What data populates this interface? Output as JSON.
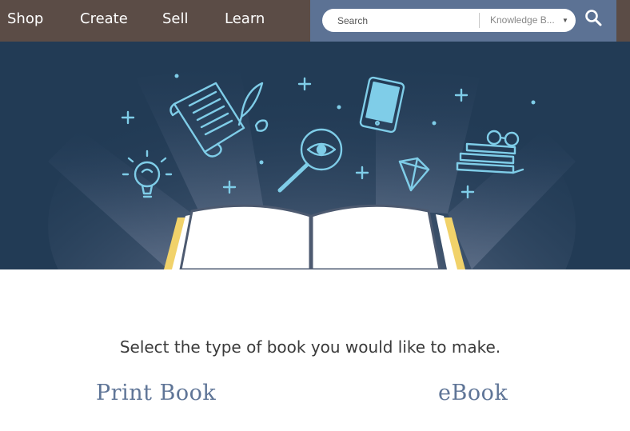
{
  "nav": {
    "items": [
      {
        "label": "Shop"
      },
      {
        "label": "Create"
      },
      {
        "label": "Sell"
      },
      {
        "label": "Learn"
      }
    ]
  },
  "search": {
    "placeholder": "Search",
    "scope": "Knowledge B...",
    "icon": "search-icon"
  },
  "colors": {
    "nav_bg": "#5b4c46",
    "search_bg": "#5c7294",
    "hero_bg": "#223b55",
    "icon_line": "#7fcde8",
    "option_text": "#5f7597",
    "book_edge": "#f1d26a"
  },
  "hero": {
    "icons": [
      "scroll-icon",
      "quill-icon",
      "ink-bottle-icon",
      "tablet-icon",
      "lightbulb-icon",
      "magnifier-eye-icon",
      "diamond-icon",
      "book-stack-glasses-icon",
      "open-book-icon"
    ]
  },
  "content": {
    "prompt": "Select the type of book you would like to make.",
    "options": [
      {
        "label": "Print Book"
      },
      {
        "label": "eBook"
      }
    ]
  }
}
